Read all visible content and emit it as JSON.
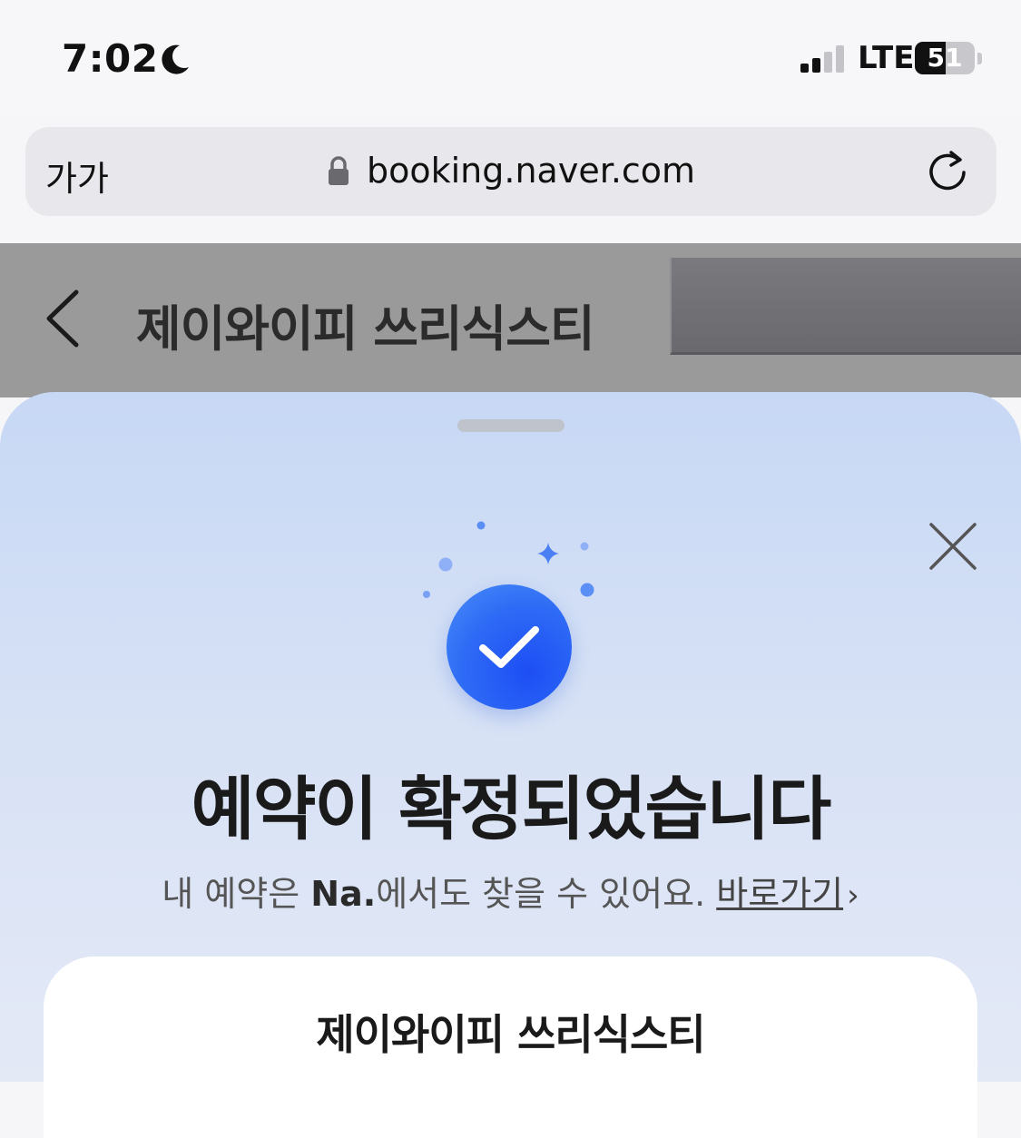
{
  "status_bar": {
    "time": "7:02",
    "network": "LTE",
    "battery_level": "51",
    "battery_fraction": 0.51,
    "icons": [
      "moon-icon",
      "signal-icon",
      "battery-icon"
    ]
  },
  "browser": {
    "text_size_label": "가가",
    "url": "booking.naver.com",
    "icons": [
      "lock-icon",
      "reload-icon"
    ]
  },
  "page": {
    "title": "제이와이피 쓰리식스티"
  },
  "sheet": {
    "title": "예약이 확정되었습니다",
    "subtitle_prefix": "내 예약은 ",
    "subtitle_brand": "Na.",
    "subtitle_suffix": "에서도 찾을 수 있어요.",
    "link_label": "바로가기",
    "link_chevron": "›",
    "card_title": "제이와이피 쓰리식스티",
    "accent_color": "#2e6bf5"
  }
}
